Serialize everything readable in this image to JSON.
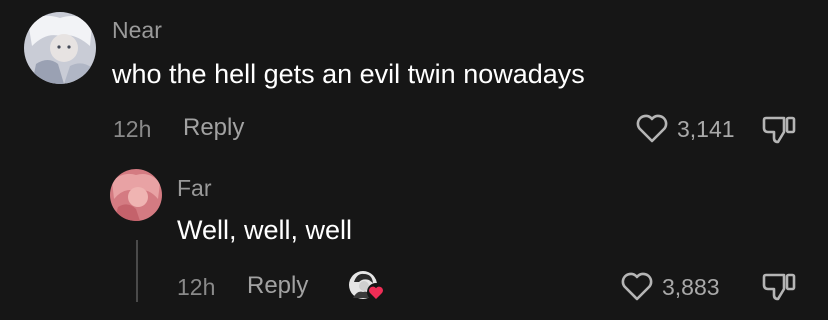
{
  "comment": {
    "username": "Near",
    "text": "who the hell gets an evil twin nowadays",
    "time": "12h",
    "reply_label": "Reply",
    "like_count": "3,141"
  },
  "reply": {
    "username": "Far",
    "text": "Well, well, well",
    "time": "12h",
    "reply_label": "Reply",
    "like_count": "3,883"
  },
  "colors": {
    "background": "#161616",
    "username": "#9a9a9a",
    "liked_by_creator_heart": "#ef2d56"
  },
  "icons": [
    "heart-icon",
    "dislike-icon",
    "creator-liked-badge-icon"
  ]
}
